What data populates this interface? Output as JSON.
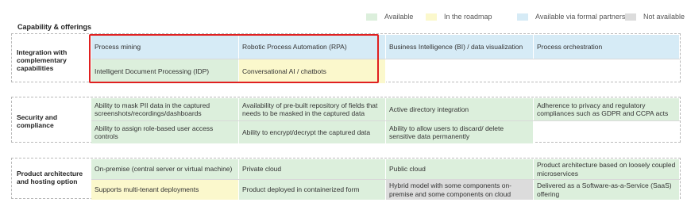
{
  "colors": {
    "available": "#dcefdc",
    "roadmap": "#fbf8cc",
    "partnership": "#d6ebf6",
    "not_available": "#dcdcdc",
    "highlight_border": "#e02020"
  },
  "legend": [
    {
      "key": "available",
      "label": "Available"
    },
    {
      "key": "roadmap",
      "label": "In the roadmap"
    },
    {
      "key": "partnership",
      "label": "Available via formal partnership"
    },
    {
      "key": "not_available",
      "label": "Not available"
    }
  ],
  "title": "Capability & offerings",
  "sections": [
    {
      "label": "Integration with complementary capabilities",
      "rows": [
        [
          {
            "text": "Process mining",
            "status": "partnership"
          },
          {
            "text": "Robotic Process Automation (RPA)",
            "status": "partnership"
          },
          {
            "text": "Business Intelligence (BI) / data visualization",
            "status": "partnership"
          },
          {
            "text": "Process orchestration",
            "status": "partnership"
          }
        ],
        [
          {
            "text": "Intelligent Document Processing (IDP)",
            "status": "available"
          },
          {
            "text": "Conversational AI / chatbots",
            "status": "roadmap"
          }
        ]
      ]
    },
    {
      "label": "Security and compliance",
      "rows": [
        [
          {
            "text": "Ability to mask PII data in the captured screenshots/recordings/dashboards",
            "status": "available"
          },
          {
            "text": "Availability of pre-built repository of fields that needs to be masked in the captured data",
            "status": "available"
          },
          {
            "text": "Active directory integration",
            "status": "available"
          },
          {
            "text": "Adherence to privacy and regulatory compliances such as GDPR and CCPA acts",
            "status": "available"
          }
        ],
        [
          {
            "text": "Ability to assign role-based user access controls",
            "status": "available"
          },
          {
            "text": "Ability to encrypt/decrypt the captured data",
            "status": "available"
          },
          {
            "text": "Ability to allow users to discard/ delete sensitive data permanently",
            "status": "available"
          }
        ]
      ]
    },
    {
      "label": "Product architecture and hosting option",
      "rows": [
        [
          {
            "text": "On-premise (central server or virtual machine)",
            "status": "available"
          },
          {
            "text": "Private cloud",
            "status": "available"
          },
          {
            "text": "Public cloud",
            "status": "available"
          },
          {
            "text": "Product architecture based on loosely coupled microservices",
            "status": "available"
          }
        ],
        [
          {
            "text": "Supports multi-tenant deployments",
            "status": "roadmap"
          },
          {
            "text": "Product deployed in containerized form",
            "status": "available"
          },
          {
            "text": "Hybrid model with some components on-premise and some components on cloud",
            "status": "not_available"
          },
          {
            "text": "Delivered as a Software-as-a-Service (SaaS) offering",
            "status": "available"
          }
        ]
      ]
    }
  ]
}
